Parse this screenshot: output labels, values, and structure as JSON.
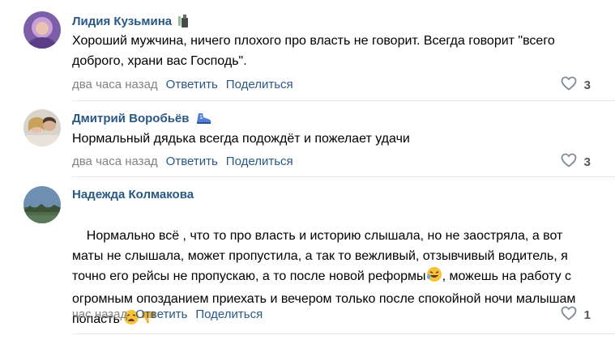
{
  "comments": [
    {
      "author": "Лидия Кузьмина",
      "text": "Хороший мужчина, ничего плохого про власть не говорит. Всегда говорит \"всего доброго, храни вас Господь\".",
      "time": "два часа назад",
      "reply_label": "Ответить",
      "share_label": "Поделиться",
      "likes": "3"
    },
    {
      "author": "Дмитрий Воробьёв",
      "text": "Нормальный дядька всегда подождёт и пожелает удачи",
      "time": "два часа назад",
      "reply_label": "Ответить",
      "share_label": "Поделиться",
      "likes": "3"
    },
    {
      "author": "Надежда Колмакова",
      "text_part1": "Нормально всё , что то про власть и историю слышала, но не заостряла, а вот маты не слышала, может пропустила, а так то вежливый, отзывчивый водитель, я точно его рейсы не пропускаю, а то после новой реформы",
      "text_part2": ", можешь на работу с огромным опозданием приехать и вечером только после спокойной ночи малышам попасть ",
      "time": "час назад",
      "reply_label": "Ответить",
      "share_label": "Поделиться",
      "likes": "1"
    }
  ],
  "colors": {
    "author": "#2a5885",
    "meta": "#828282",
    "divider": "#e7e8ec"
  }
}
